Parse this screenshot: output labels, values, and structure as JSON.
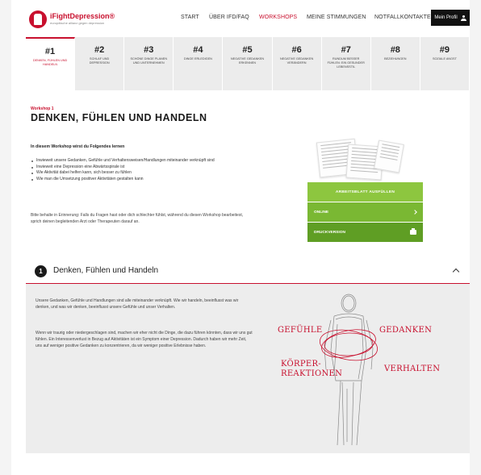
{
  "header": {
    "logo_title": "iFightDepression®",
    "logo_subtitle": "europäische allianz gegen depression",
    "nav": [
      "START",
      "ÜBER IFD/FAQ",
      "WORKSHOPS",
      "MEINE STIMMUNGEN",
      "NOTFALLKONTAKTE"
    ],
    "active_nav": "WORKSHOPS",
    "profile_label": "Mein Profil"
  },
  "tabs": [
    {
      "num": "#1",
      "label": "Denken, Fühlen und Handeln"
    },
    {
      "num": "#2",
      "label": "Schlaf und Depression"
    },
    {
      "num": "#3",
      "label": "Schöne Dinge planen und unternehmen"
    },
    {
      "num": "#4",
      "label": "Dinge erledigen"
    },
    {
      "num": "#5",
      "label": "Negative Gedanken erkennen"
    },
    {
      "num": "#6",
      "label": "Negative Gedanken verändern"
    },
    {
      "num": "#7",
      "label": "Rundum besser fühlen: ein gesunder Lebensstil"
    },
    {
      "num": "#8",
      "label": "Beziehungen"
    },
    {
      "num": "#9",
      "label": "Soziale Angst"
    }
  ],
  "main": {
    "kicker": "Workshop 1",
    "title": "DENKEN, FÜHLEN UND HANDELN",
    "lead": "In diesem Workshop wirst du Folgendes lernen",
    "bullets": [
      "Inwieweit unsere Gedanken, Gefühle und Verhaltensweisen/Handlungen miteinander verknüpft sind",
      "Inwieweit eine Depression eine Abwärtsspirale ist",
      "Wie Aktivität dabei helfen kann, sich besser zu fühlen",
      "Wie man die Umsetzung positiver Aktivitäten gestalten kann"
    ],
    "reminder": "Bitte behalte in Erinnerung: Falls du Fragen hast oder dich schlechter fühlst, während du diesen Workshop bearbeitest, sprich deinen begleitenden Arzt oder Therapeuten darauf an."
  },
  "worksheet": {
    "header": "Arbeitsblatt ausfüllen",
    "online": "Online",
    "print": "Druckversion"
  },
  "accordion": {
    "number": "1",
    "title": "Denken, Fühlen und Handeln",
    "paragraphs": [
      "Unsere Gedanken, Gefühle und Handlungen sind alle miteinander verknüpft. Wie wir handeln, beeinflusst was wir denken, und was wir denken, beeinflusst unsere Gefühle und unser Verhalten.",
      "Wenn wir traurig oder niedergeschlagen sind, machen wir eher nicht die Dinge, die dazu führen könnten, dass wir uns gut fühlen. Ein Interessenverlust in Bezug auf Aktivitäten ist ein Symptom einer Depression. Dadurch haben wir mehr Zeit, uns auf weniger positive Gedanken zu konzentrieren, da wir weniger positive Erlebnisse haben."
    ],
    "figure_words": {
      "feelings": "GEFÜHLE",
      "thoughts": "GEDANKEN",
      "body_1": "KÖRPER-",
      "body_2": "REAKTIONEN",
      "behavior": "VERHALTEN"
    }
  },
  "colors": {
    "brand_red": "#c8102e",
    "green": "#8dc63f",
    "green_dark": "#5f9e24",
    "header_dark": "#111111"
  }
}
